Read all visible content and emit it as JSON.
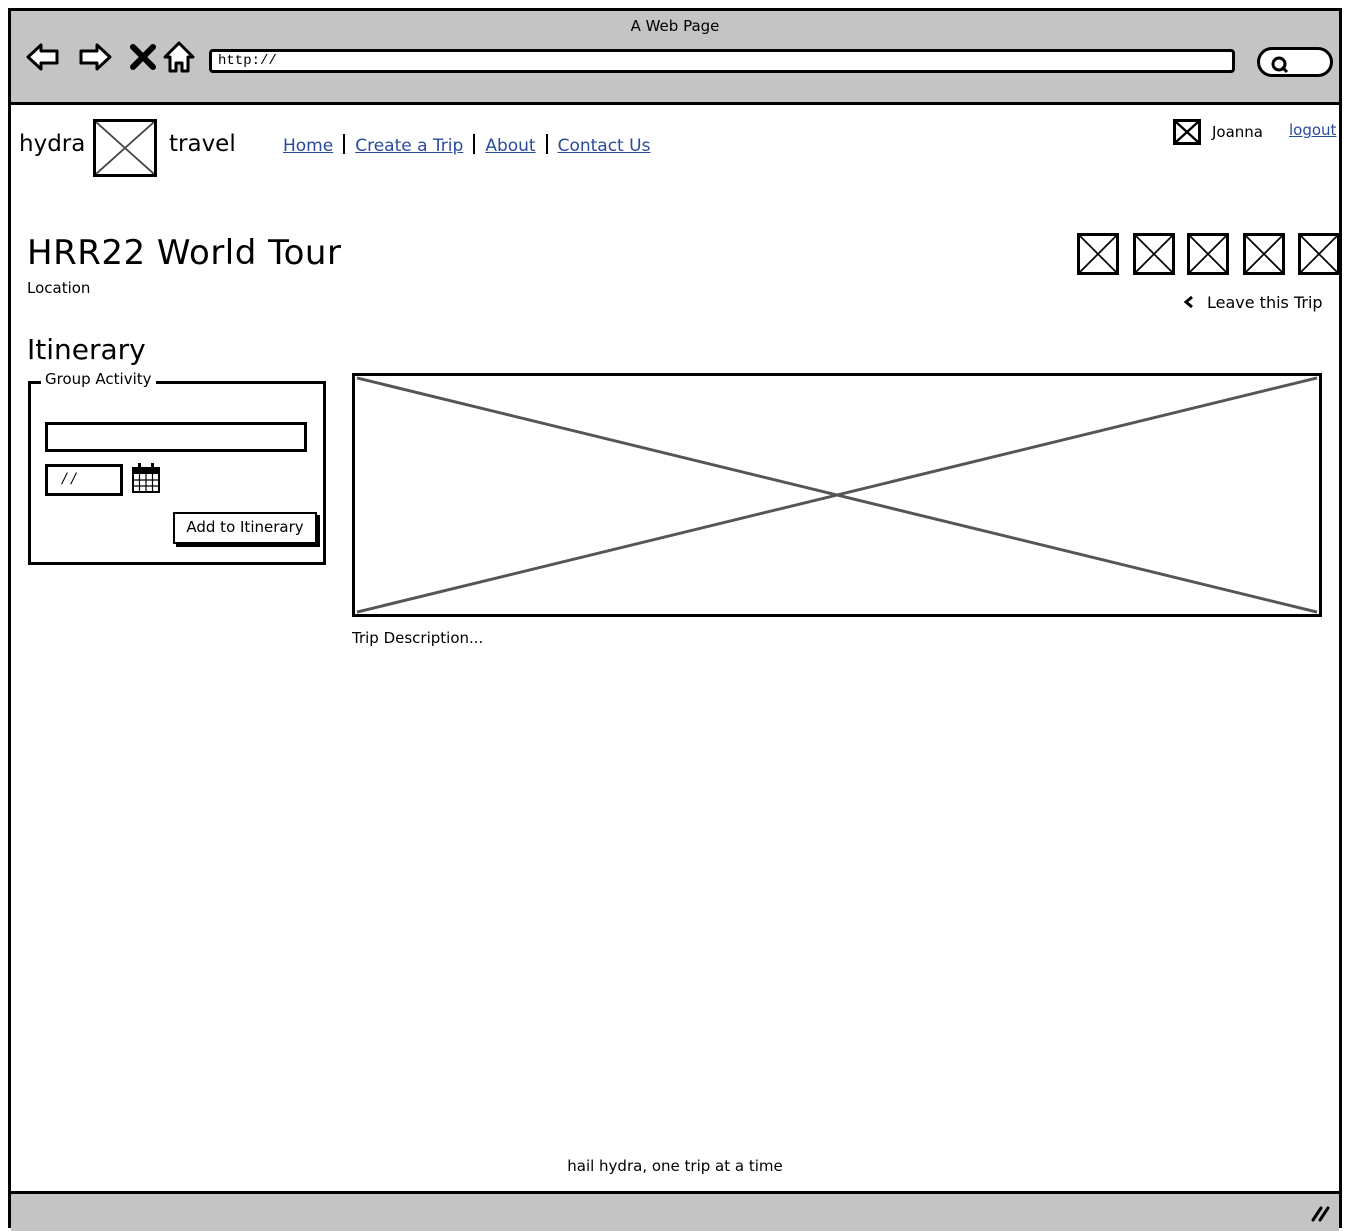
{
  "browser": {
    "title": "A Web Page",
    "url": "http://"
  },
  "header": {
    "logo_left": "hydra",
    "logo_right": "travel",
    "nav": [
      {
        "label": "Home"
      },
      {
        "label": "Create a Trip"
      },
      {
        "label": "About"
      },
      {
        "label": "Contact Us"
      }
    ],
    "user_name": "Joanna",
    "logout_label": "logout"
  },
  "trip": {
    "title": "HRR22 World Tour",
    "location": "Location",
    "leave_label": "Leave this Trip",
    "description": "Trip Description..."
  },
  "itinerary": {
    "heading": "Itinerary",
    "group_label": "Group Activity",
    "activity_value": "",
    "date_value": "/ /",
    "add_button_label": "Add to Itinerary"
  },
  "footer": {
    "tagline": "hail hydra, one trip at a time"
  },
  "icons": {
    "back": "back-arrow-icon",
    "forward": "forward-arrow-icon",
    "stop": "close-icon",
    "home": "home-icon",
    "search": "search-icon",
    "calendar": "calendar-icon",
    "leave": "chevron-left-icon"
  }
}
